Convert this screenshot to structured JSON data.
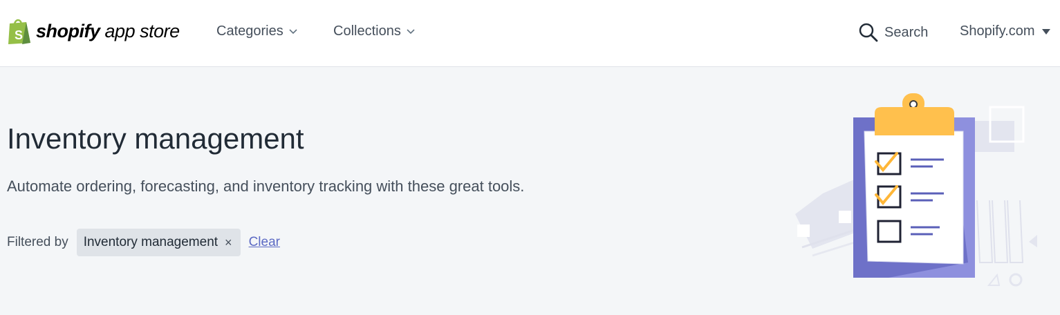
{
  "header": {
    "logo_brand": "shopify",
    "logo_suffix": "app store",
    "nav": [
      {
        "label": "Categories",
        "icon": "chevron-down-icon"
      },
      {
        "label": "Collections",
        "icon": "chevron-down-icon"
      }
    ],
    "search_label": "Search",
    "shopify_link": "Shopify.com"
  },
  "hero": {
    "title": "Inventory management",
    "description": "Automate ordering, forecasting, and inventory tracking with these great tools.",
    "filter_label": "Filtered by",
    "filter_chip": "Inventory management",
    "chip_remove": "×",
    "clear_label": "Clear"
  },
  "illustration": {
    "icon": "clipboard-checklist-illustration",
    "checklist_checked": [
      true,
      true,
      false
    ]
  },
  "colors": {
    "brand_green": "#95bf47",
    "link": "#5c6ac4",
    "clip_orange": "#ffc04d",
    "board_purple": "#6e71c8"
  }
}
